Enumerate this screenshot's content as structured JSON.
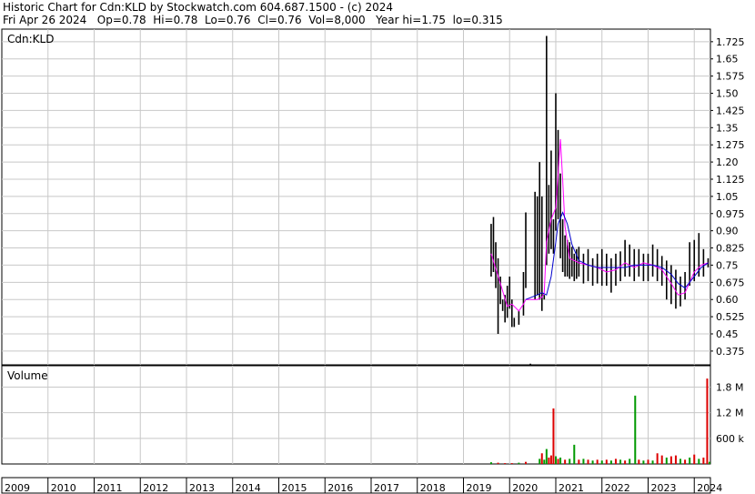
{
  "header": {
    "line1": "Historic Chart for Cdn:KLD by Stockwatch.com 604.687.1500 - (c) 2024",
    "line2": "Fri Apr 26 2024   Op=0.78  Hi=0.78  Lo=0.76  Cl=0.76  Vol=8,000   Year hi=1.75  lo=0.315"
  },
  "colors": {
    "price": "#000000",
    "ma_short": "#ff00ff",
    "ma_long": "#0000cc",
    "vol_up": "#009900",
    "vol_down": "#dd0000",
    "grid": "#c8c8c8"
  },
  "chart_data": [
    {
      "type": "line",
      "panel": "price",
      "title": "Cdn:KLD",
      "xlabel": "",
      "ylabel": "",
      "ylim": [
        0.315,
        1.78
      ],
      "y_ticks": [
        "1.725",
        "1.65",
        "1.575",
        "1.50",
        "1.425",
        "1.35",
        "1.275",
        "1.20",
        "1.125",
        "1.05",
        "0.975",
        "0.90",
        "0.825",
        "0.75",
        "0.675",
        "0.60",
        "0.525",
        "0.45",
        "0.375"
      ],
      "x_ticks": [
        "2009",
        "2010",
        "2011",
        "2012",
        "2013",
        "2014",
        "2015",
        "2016",
        "2017",
        "2018",
        "2019",
        "2020",
        "2021",
        "2022",
        "2023",
        "2024"
      ],
      "x_range": [
        2009.0,
        2024.35
      ],
      "grid": true,
      "series": [
        {
          "kind": "high-low bars",
          "x": [
            2019.6,
            2019.65,
            2019.7,
            2019.75,
            2019.8,
            2019.85,
            2019.9,
            2019.95,
            2020.0,
            2020.05,
            2020.1,
            2020.2,
            2020.3,
            2020.35,
            2020.45,
            2020.55,
            2020.6,
            2020.65,
            2020.7,
            2020.75,
            2020.8,
            2020.85,
            2020.9,
            2020.95,
            2021.0,
            2021.05,
            2021.1,
            2021.15,
            2021.2,
            2021.25,
            2021.3,
            2021.35,
            2021.4,
            2021.45,
            2021.5,
            2021.6,
            2021.7,
            2021.8,
            2021.9,
            2022.0,
            2022.1,
            2022.2,
            2022.3,
            2022.4,
            2022.5,
            2022.6,
            2022.7,
            2022.8,
            2022.9,
            2023.0,
            2023.1,
            2023.2,
            2023.3,
            2023.4,
            2023.5,
            2023.6,
            2023.7,
            2023.8,
            2023.9,
            2024.0,
            2024.1,
            2024.2,
            2024.3
          ],
          "high": [
            0.93,
            0.96,
            0.85,
            0.78,
            0.7,
            0.6,
            0.62,
            0.66,
            0.7,
            0.6,
            0.52,
            0.55,
            0.72,
            0.98,
            0.32,
            1.07,
            1.05,
            1.2,
            1.05,
            0.62,
            1.75,
            1.1,
            1.25,
            0.95,
            1.5,
            1.34,
            1.15,
            0.95,
            0.88,
            0.86,
            0.85,
            0.83,
            0.8,
            0.82,
            0.83,
            0.8,
            0.82,
            0.78,
            0.8,
            0.82,
            0.8,
            0.78,
            0.8,
            0.81,
            0.86,
            0.84,
            0.82,
            0.82,
            0.8,
            0.8,
            0.84,
            0.82,
            0.79,
            0.77,
            0.75,
            0.73,
            0.7,
            0.72,
            0.85,
            0.86,
            0.89,
            0.82,
            0.78
          ],
          "low": [
            0.7,
            0.72,
            0.65,
            0.45,
            0.58,
            0.55,
            0.5,
            0.52,
            0.56,
            0.48,
            0.48,
            0.49,
            0.53,
            0.65,
            0.31,
            0.6,
            0.62,
            0.6,
            0.55,
            0.6,
            0.75,
            0.8,
            0.82,
            0.8,
            0.9,
            0.95,
            0.78,
            0.72,
            0.7,
            0.7,
            0.69,
            0.7,
            0.68,
            0.69,
            0.7,
            0.67,
            0.68,
            0.66,
            0.67,
            0.66,
            0.66,
            0.63,
            0.66,
            0.68,
            0.7,
            0.7,
            0.68,
            0.7,
            0.68,
            0.68,
            0.7,
            0.68,
            0.66,
            0.6,
            0.58,
            0.56,
            0.57,
            0.6,
            0.66,
            0.68,
            0.7,
            0.7,
            0.74
          ]
        },
        {
          "name": "",
          "kind": "moving average (short)",
          "x": [
            2019.6,
            2019.8,
            2019.95,
            2020.05,
            2020.2,
            2020.3,
            2020.35,
            2020.6,
            2020.7,
            2020.75,
            2020.8,
            2020.9,
            2021.0,
            2021.1,
            2021.15,
            2021.2,
            2021.3,
            2021.5,
            2021.7,
            2021.9,
            2022.1,
            2022.3,
            2022.5,
            2022.7,
            2022.9,
            2023.1,
            2023.3,
            2023.5,
            2023.65,
            2023.8,
            2024.0,
            2024.15,
            2024.3
          ],
          "y": [
            0.8,
            0.67,
            0.57,
            0.58,
            0.55,
            0.58,
            0.6,
            0.6,
            0.61,
            0.63,
            0.85,
            0.95,
            1.0,
            1.3,
            1.12,
            0.92,
            0.78,
            0.76,
            0.75,
            0.74,
            0.72,
            0.73,
            0.76,
            0.74,
            0.76,
            0.75,
            0.73,
            0.67,
            0.62,
            0.63,
            0.72,
            0.75,
            0.76
          ]
        },
        {
          "name": "",
          "kind": "moving average (long)",
          "x": [
            2020.35,
            2020.6,
            2020.7,
            2020.8,
            2020.9,
            2021.0,
            2021.05,
            2021.15,
            2021.25,
            2021.35,
            2021.5,
            2021.7,
            2021.9,
            2022.1,
            2022.3,
            2022.5,
            2022.7,
            2022.9,
            2023.1,
            2023.3,
            2023.5,
            2023.65,
            2023.8,
            2024.0,
            2024.15,
            2024.3
          ],
          "y": [
            0.6,
            0.62,
            0.63,
            0.62,
            0.7,
            0.85,
            0.93,
            0.98,
            0.93,
            0.84,
            0.77,
            0.75,
            0.74,
            0.74,
            0.74,
            0.74,
            0.75,
            0.75,
            0.75,
            0.74,
            0.71,
            0.67,
            0.65,
            0.7,
            0.74,
            0.76
          ]
        }
      ]
    },
    {
      "type": "bar",
      "panel": "volume",
      "title": "Volume",
      "y_ticks": [
        "1.8 M",
        "1.2 M",
        "600 k"
      ],
      "ylim": [
        0,
        2.3
      ],
      "units": "millions of shares",
      "grid": true,
      "bars": [
        {
          "x": 2019.6,
          "v": 0.04,
          "up": true
        },
        {
          "x": 2019.75,
          "v": 0.03,
          "up": false
        },
        {
          "x": 2019.9,
          "v": 0.02,
          "up": false
        },
        {
          "x": 2020.05,
          "v": 0.02,
          "up": false
        },
        {
          "x": 2020.2,
          "v": 0.03,
          "up": true
        },
        {
          "x": 2020.35,
          "v": 0.05,
          "up": false
        },
        {
          "x": 2020.65,
          "v": 0.12,
          "up": true
        },
        {
          "x": 2020.7,
          "v": 0.25,
          "up": false
        },
        {
          "x": 2020.75,
          "v": 0.1,
          "up": true
        },
        {
          "x": 2020.8,
          "v": 0.35,
          "up": true
        },
        {
          "x": 2020.85,
          "v": 0.15,
          "up": false
        },
        {
          "x": 2020.9,
          "v": 0.2,
          "up": false
        },
        {
          "x": 2020.95,
          "v": 1.3,
          "up": false
        },
        {
          "x": 2021.0,
          "v": 0.18,
          "up": true
        },
        {
          "x": 2021.05,
          "v": 0.12,
          "up": false
        },
        {
          "x": 2021.1,
          "v": 0.15,
          "up": true
        },
        {
          "x": 2021.2,
          "v": 0.1,
          "up": false
        },
        {
          "x": 2021.3,
          "v": 0.12,
          "up": true
        },
        {
          "x": 2021.4,
          "v": 0.45,
          "up": true
        },
        {
          "x": 2021.5,
          "v": 0.1,
          "up": false
        },
        {
          "x": 2021.6,
          "v": 0.12,
          "up": true
        },
        {
          "x": 2021.7,
          "v": 0.1,
          "up": false
        },
        {
          "x": 2021.8,
          "v": 0.08,
          "up": true
        },
        {
          "x": 2021.9,
          "v": 0.1,
          "up": false
        },
        {
          "x": 2022.0,
          "v": 0.08,
          "up": true
        },
        {
          "x": 2022.1,
          "v": 0.1,
          "up": false
        },
        {
          "x": 2022.2,
          "v": 0.08,
          "up": true
        },
        {
          "x": 2022.3,
          "v": 0.12,
          "up": false
        },
        {
          "x": 2022.4,
          "v": 0.1,
          "up": true
        },
        {
          "x": 2022.5,
          "v": 0.08,
          "up": false
        },
        {
          "x": 2022.6,
          "v": 0.12,
          "up": true
        },
        {
          "x": 2022.72,
          "v": 1.6,
          "up": true
        },
        {
          "x": 2022.8,
          "v": 0.1,
          "up": false
        },
        {
          "x": 2022.9,
          "v": 0.08,
          "up": true
        },
        {
          "x": 2023.0,
          "v": 0.1,
          "up": false
        },
        {
          "x": 2023.1,
          "v": 0.08,
          "up": true
        },
        {
          "x": 2023.2,
          "v": 0.25,
          "up": false
        },
        {
          "x": 2023.3,
          "v": 0.2,
          "up": false
        },
        {
          "x": 2023.4,
          "v": 0.15,
          "up": true
        },
        {
          "x": 2023.5,
          "v": 0.18,
          "up": false
        },
        {
          "x": 2023.6,
          "v": 0.2,
          "up": false
        },
        {
          "x": 2023.7,
          "v": 0.12,
          "up": true
        },
        {
          "x": 2023.8,
          "v": 0.1,
          "up": false
        },
        {
          "x": 2023.9,
          "v": 0.15,
          "up": true
        },
        {
          "x": 2024.0,
          "v": 0.22,
          "up": false
        },
        {
          "x": 2024.1,
          "v": 0.12,
          "up": true
        },
        {
          "x": 2024.2,
          "v": 0.15,
          "up": false
        },
        {
          "x": 2024.28,
          "v": 2.0,
          "up": false
        },
        {
          "x": 2024.33,
          "v": 0.05,
          "up": true
        }
      ]
    }
  ]
}
